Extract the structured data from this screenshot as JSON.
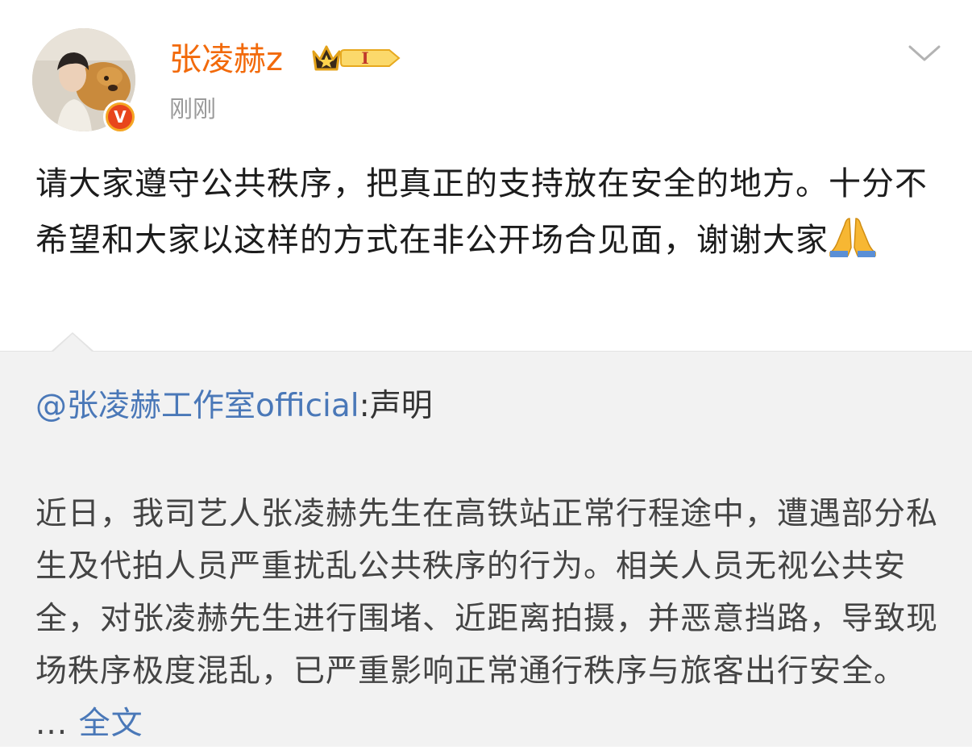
{
  "post": {
    "username": "张凌赫z",
    "rank_label": "I",
    "timestamp": "刚刚",
    "text": "请大家遵守公共秩序，把真正的支持放在安全的地方。十分不希望和大家以这样的方式在非公开场合见面，谢谢大家",
    "emoji": "pray-emoji",
    "verified_mark": "V"
  },
  "repost": {
    "mention": "@张凌赫工作室official",
    "head_rest": ":声明",
    "body": "近日，我司艺人张凌赫先生在高铁站正常行程途中，遭遇部分私生及代拍人员严重扰乱公共秩序的行为。相关人员无视公共安全，对张凌赫先生进行围堵、近距离拍摄，并恶意挡路，导致现场秩序极度混乱，已严重影响正常通行秩序与旅客出行安全。",
    "ellipsis": "...",
    "full_text_link": "全文"
  },
  "colors": {
    "username": "#f26a0b",
    "link": "#4a78b8",
    "repost_bg": "#f2f2f2",
    "timestamp": "#9a9a9a"
  }
}
